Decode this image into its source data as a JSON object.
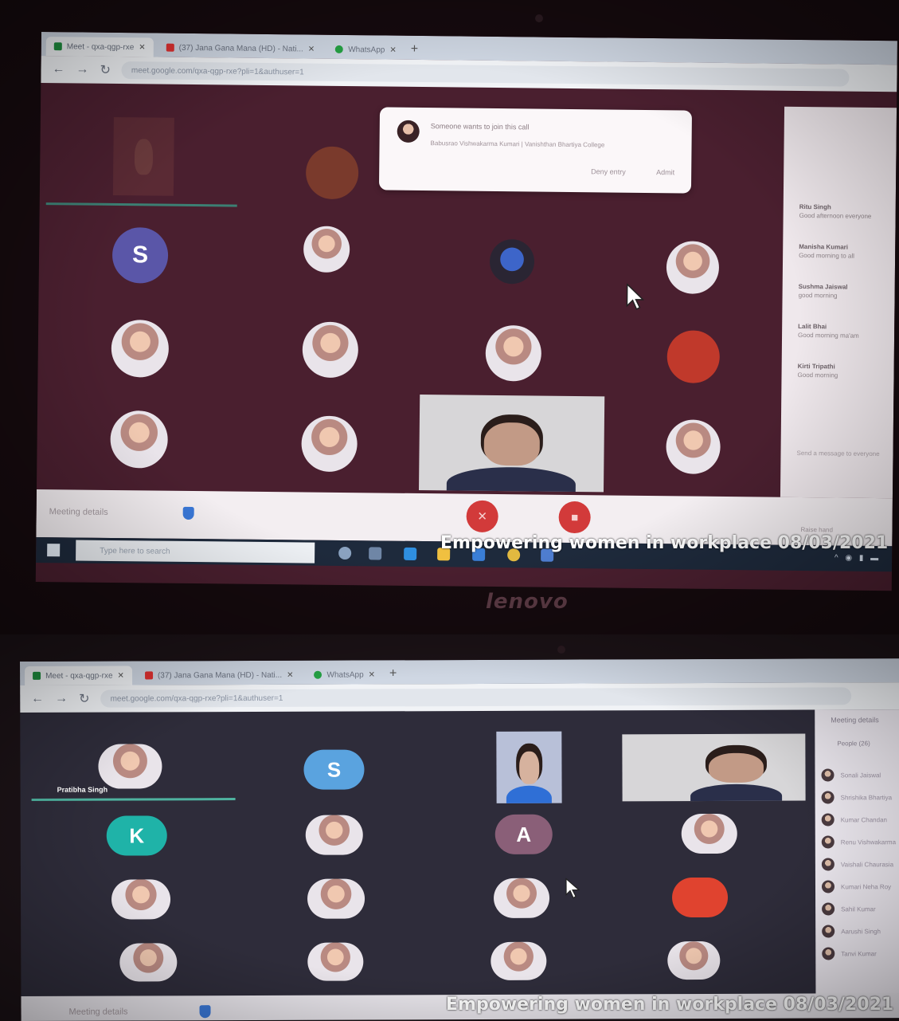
{
  "caption": "Empowering women in workplace 08/03/2021",
  "laptop_brand": "lenovo",
  "colors": {
    "meet_bg_top": "#4a1f2f",
    "meet_bg_bottom": "#2e2c3a",
    "end_call": "#d23a3a",
    "accent_green": "#4fb3a0",
    "taskbar": "#1e2a3c"
  },
  "browser": {
    "tabs": [
      {
        "label": "Meet - qxa-qgp-rxe",
        "icon": "meet-icon",
        "active": true
      },
      {
        "label": "(37) Jana Gana Mana (HD) - Nati...",
        "icon": "youtube-icon",
        "active": false
      },
      {
        "label": "WhatsApp",
        "icon": "whatsapp-icon",
        "active": false
      }
    ],
    "url": "meet.google.com/qxa-qgp-rxe?pli=1&authuser=1"
  },
  "screen1": {
    "join_request": {
      "title": "Someone wants to join this call",
      "subtitle": "Babusrao Vishwakarma Kumari | Vanishthan Bhartiya College",
      "deny_label": "Deny entry",
      "admit_label": "Admit"
    },
    "chat": [
      {
        "name": "Ritu Singh",
        "text": "Good afternoon everyone"
      },
      {
        "name": "Manisha Kumari",
        "text": "Good morning to all"
      },
      {
        "name": "Sushma Jaiswal",
        "text": "good morning"
      },
      {
        "name": "Lalit Bhai",
        "text": "Good morning ma'am"
      },
      {
        "name": "Kirti Tripathi",
        "text": "Good morning"
      }
    ],
    "chat_placeholder": "Send a message to everyone",
    "meeting_details": "Meeting details",
    "raise_hand": "Raise hand",
    "taskbar_search": "Type here to search",
    "avatar_letter": "S"
  },
  "screen2": {
    "speaker_name": "Pratibha Singh",
    "avatar_letters": [
      "S",
      "K",
      "A"
    ],
    "people_panel": {
      "title": "Meeting details",
      "tab": "People (26)",
      "names": [
        "Sonali Jaiswal",
        "Shrishika Bhartiya",
        "Kumar Chandan",
        "Renu Vishwakarma",
        "Vaishali Chaurasia",
        "Kumari Neha Roy",
        "Sahil Kumar",
        "Aarushi Singh",
        "Tanvi Kumar"
      ]
    },
    "meeting_details": "Meeting details"
  }
}
